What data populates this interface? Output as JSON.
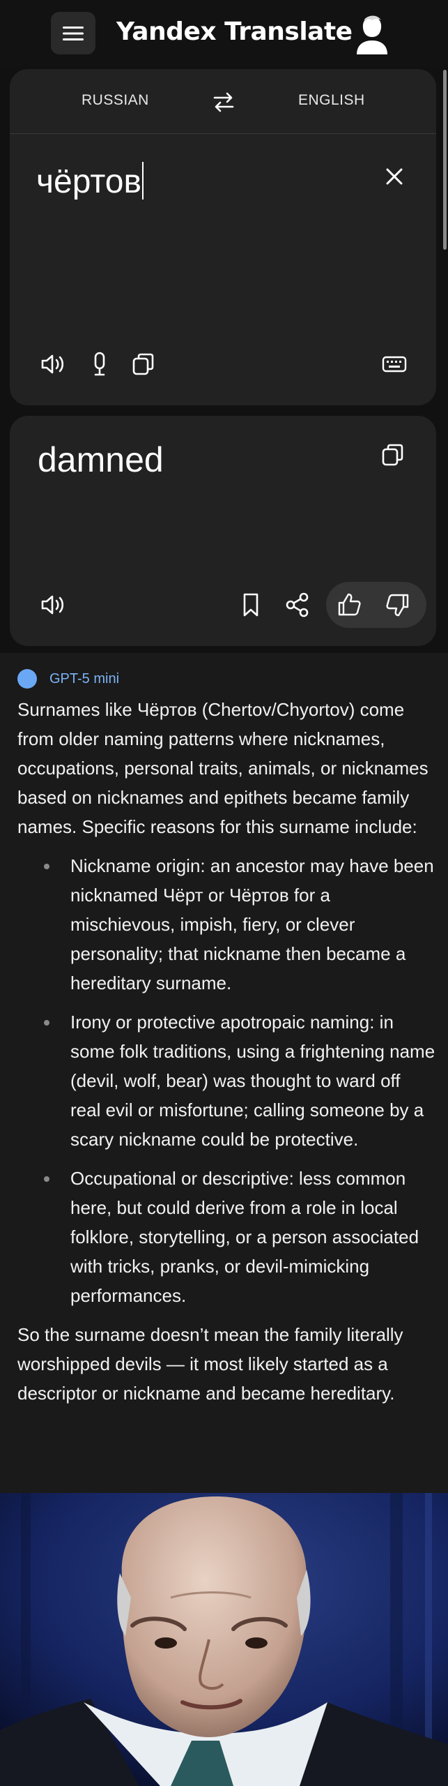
{
  "app": {
    "title": "Yandex Translate"
  },
  "header": {
    "menu_icon": "hamburger-icon",
    "account_icon": "user-avatar-icon"
  },
  "languages": {
    "source": "RUSSIAN",
    "target": "ENGLISH",
    "swap_icon": "swap-arrows-icon"
  },
  "source": {
    "text": "чёртов"
  },
  "target": {
    "text": "damned"
  },
  "gpt": {
    "model": "GPT-5 mini",
    "intro": "Surnames like Чёртов (Chertov/Chyortov) come from older naming patterns where nicknames, occupations, personal traits, animals, or nicknames based on nicknames and epithets became family names. Specific reasons for this surname include:",
    "bullets": [
      "Nickname origin: an ancestor may have been nicknamed Чёрт or Чёртов for a mischievous, impish, fiery, or clever personality; that nickname then became a hereditary surname.",
      "Irony or protective apotropaic naming: in some folk traditions, using a frightening name (devil, wolf, bear) was thought to ward off real evil or misfortune; calling someone by a scary nickname could be protective.",
      "Occupational or descriptive: less common here, but could derive from a role in local folklore, storytelling, or a person associated with tricks, pranks, or devil-mimicking performances."
    ],
    "conclusion": "So the surname doesn’t mean the family literally worshipped devils — it most likely started as a descriptor or nickname and became hereditary."
  },
  "colors": {
    "background": "#111111",
    "card": "#222222",
    "accent": "#6aa8f5",
    "rate_pill": "#353535"
  }
}
